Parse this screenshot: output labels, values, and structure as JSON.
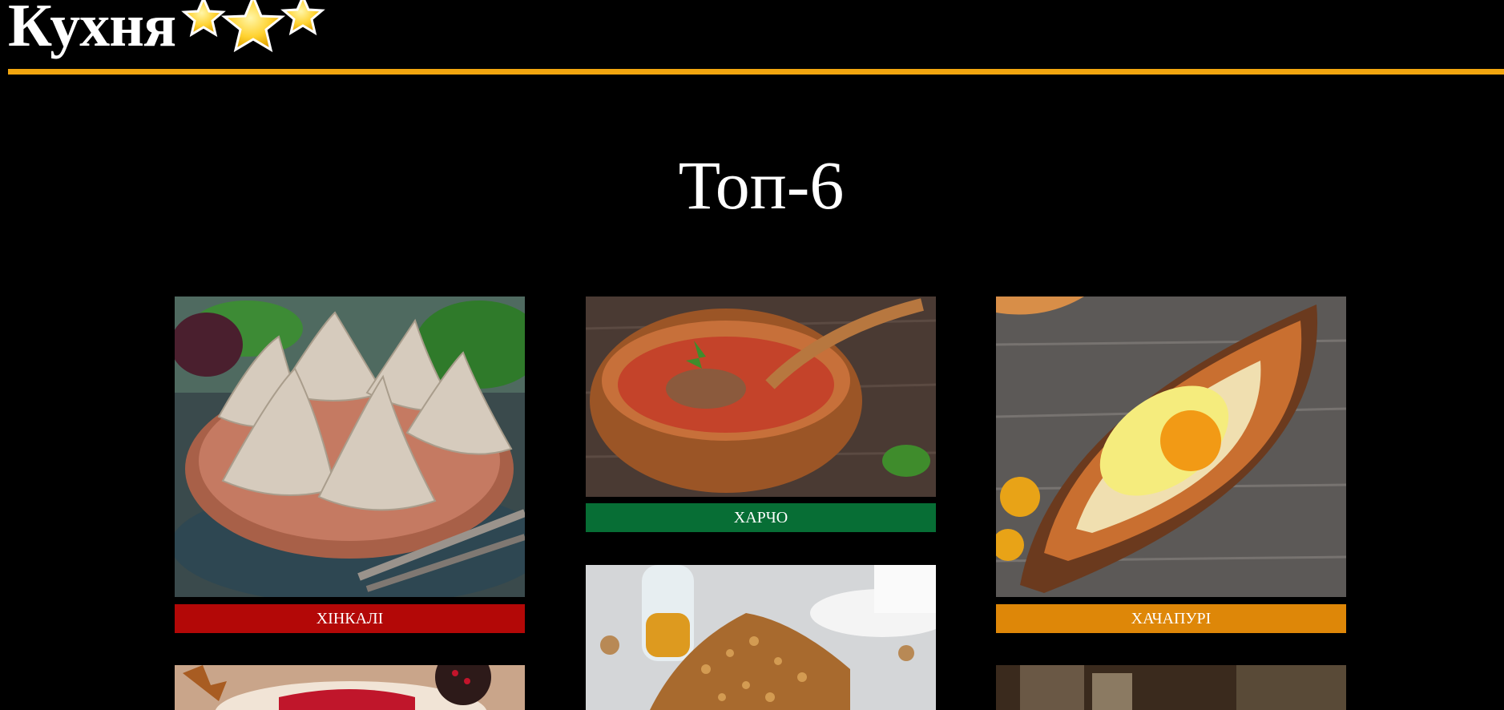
{
  "header": {
    "title": "Кухня",
    "logo_icon": "three-stars-icon",
    "accent_color": "#f2a60f"
  },
  "main": {
    "title": "Топ-6",
    "dishes": [
      {
        "name": "ХІНКАЛІ",
        "color": "#b30807",
        "photo_icon": "khinkali-photo"
      },
      {
        "name": "ХАРЧО",
        "color": "#076e35",
        "photo_icon": "kharcho-photo"
      },
      {
        "name": "ХАЧАПУРІ",
        "color": "#de8708",
        "photo_icon": "khachapuri-photo"
      }
    ]
  }
}
